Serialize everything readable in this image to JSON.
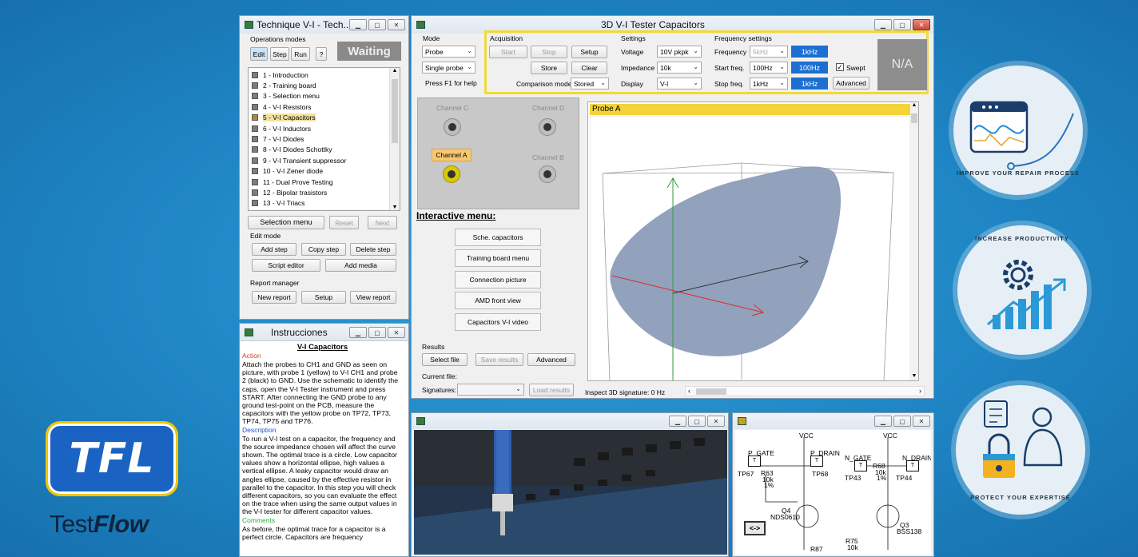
{
  "win_technique": {
    "title": "Technique V-I - Tech...",
    "operations_label": "Operations modes",
    "tabs": [
      "Edit",
      "Step",
      "Run",
      "?"
    ],
    "status": "Waiting",
    "steps": [
      "1 - Introduction",
      "2 - Training board",
      "3 - Selection menu",
      "4 - V-I Resistors",
      "5 - V-I Capacitors",
      "6 - V-I Inductors",
      "7 - V-I Diodes",
      "8 - V-I Diodes Schottky",
      "9 - V-I Transient suppressor",
      "10 - V-I Zener diode",
      "11 - Dual Prove Testing",
      "12 - Bipolar trasistors",
      "13 - V-I Triacs"
    ],
    "selected_step_index": 4,
    "selection_menu": "Selection menu",
    "reset": "Reset",
    "next": "Next",
    "edit_mode": "Edit mode",
    "add_step": "Add step",
    "copy_step": "Copy step",
    "delete_step": "Delete step",
    "script_editor": "Script editor",
    "add_media": "Add media",
    "report_manager": "Report manager",
    "new_report": "New report",
    "setup": "Setup",
    "view_report": "View report"
  },
  "win_tester": {
    "title": "3D V-I Tester Capacitors",
    "mode_label": "Mode",
    "mode_value": "Probe",
    "probe_value": "Single probe",
    "help": "Press F1 for help",
    "acquisition_label": "Acquisition",
    "start": "Start",
    "stop": "Stop",
    "setup": "Setup",
    "store": "Store",
    "clear": "Clear",
    "comparison_label": "Comparison mode",
    "comparison_value": "Stored",
    "settings_label": "Settings",
    "voltage_label": "Voltage",
    "voltage_value": "10V pkpk",
    "impedance_label": "Impedance",
    "impedance_value": "10k",
    "display_label": "Display",
    "display_value": "V-I",
    "freq_settings_label": "Frequency settings",
    "frequency_label": "Frequency",
    "frequency_value": "5kHz",
    "frequency_box": "1kHz",
    "start_freq_label": "Start freq.",
    "start_freq_value": "100Hz",
    "start_freq_box": "100Hz",
    "stop_freq_label": "Stop freq.",
    "stop_freq_value": "1kHz",
    "stop_freq_box": "1kHz",
    "swept": "Swept",
    "advanced": "Advanced",
    "na": "N/A",
    "channel_c": "Channel C",
    "channel_d": "Channel D",
    "channel_a": "Channel A",
    "channel_b": "Channel B",
    "interactive_menu": "Interactive menu:",
    "menu_items": [
      "Sche. capacitors",
      "Training board menu",
      "Connection picture",
      "AMD front view",
      "Capacitors V-I video"
    ],
    "results_label": "Results",
    "select_file": "Select file",
    "save_results": "Save results",
    "results_advanced": "Advanced",
    "current_file_label": "Current file:",
    "signatures_label": "Signatures:",
    "load_results": "Load results",
    "probe_title": "Probe A",
    "inspect": "Inspect 3D signature:  0 Hz"
  },
  "win_instructions": {
    "title": "Instrucciones",
    "heading": "V-I Capacitors",
    "action_label": "Action",
    "action_text": "Attach the probes to CH1 and GND as seen on picture, with probe 1 (yellow) to V-I CH1 and probe 2 (black) to GND.  Use the schematic to identify the caps, open the V-I Tester instrument and press START.  After connecting the GND probe to any ground test-point on the PCB, measure the capacitors with the yellow probe on TP72, TP73, TP74, TP75 and TP76.",
    "description_label": "Description",
    "description_text": "To run a V-I test on a capacitor, the frequency and the source impedance chosen will affect the curve shown.  The optimal trace is a circle.  Low capacitor values show a horizontal ellipse, high values a vertical ellipse.  A leaky capacitor would draw an angles ellipse, caused by the effective resistor in parallel to the capacitor.  In this step you will check different capacitors, so you can evaluate the effect on the trace when using the same output values in the V-I tester for different capacitor values.",
    "comments_label": "Comments",
    "comments_text": "As before, the optimal trace for a capacitor is a perfect circle.  Capacitors are frequency"
  },
  "schematic": {
    "vcc": "VCC",
    "p_gate": "P_GATE",
    "p_drain": "P_DRAIN",
    "n_gate": "N_GATE",
    "n_drain": "N_DRAIN",
    "tp67": "TP67",
    "tp68": "TP68",
    "tp43": "TP43",
    "tp44": "TP44",
    "r63": "R63",
    "r68": "R68",
    "r10k": "10k",
    "r1pct": "1%",
    "q4": "Q4",
    "q4_part": "NDS0610",
    "q3": "Q3",
    "q3_part": "BSS138",
    "r87": "R87",
    "r75": "R75",
    "nav": "<->",
    "t": "T"
  },
  "branding": {
    "logo": "TFL",
    "brand_plain": "Test",
    "brand_bold": "Flow",
    "badge1": "IMPROVE YOUR REPAIR PROCESS",
    "badge2": "INCREASE PRODUCTIVITY",
    "badge3": "PROTECT YOUR EXPERTISE"
  },
  "colors": {
    "accent_blue": "#1c6fd1",
    "highlight_yellow": "#f0da3a",
    "trace_fill": "#8c9db9"
  }
}
